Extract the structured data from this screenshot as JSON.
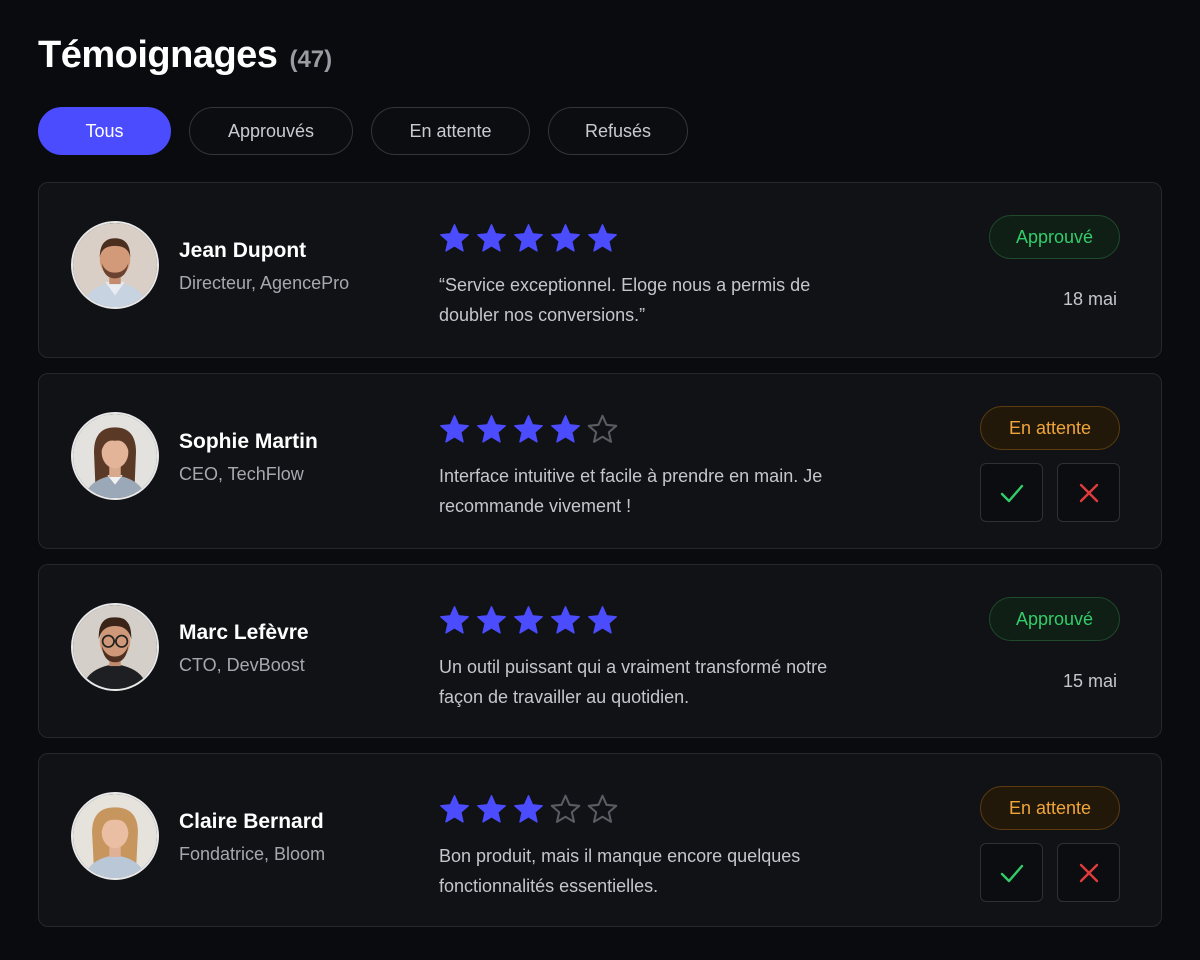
{
  "header": {
    "title": "Témoignages",
    "count": "(47)"
  },
  "tabs": [
    {
      "label": "Tous",
      "active": true
    },
    {
      "label": "Approuvés",
      "active": false
    },
    {
      "label": "En attente",
      "active": false
    },
    {
      "label": "Refusés",
      "active": false
    }
  ],
  "colors": {
    "accent": "#4c4cff",
    "approved": "#33cc6a",
    "pending": "#f0a53a",
    "reject": "#e03b3b",
    "star_empty": "#5a5c63"
  },
  "testimonials": [
    {
      "name": "Jean Dupont",
      "role": "Directeur, AgencePro",
      "rating": 5,
      "quote": "“Service exceptionnel. Eloge nous a permis de doubler nos conversions.”",
      "status": "Approuvé",
      "date": "18 mai"
    },
    {
      "name": "Sophie Martin",
      "role": "CEO, TechFlow",
      "rating": 4,
      "quote": "Interface intuitive et facile à prendre en main. Je recommande vivement !",
      "status": "En attente",
      "date": ""
    },
    {
      "name": "Marc Lefèvre",
      "role": "CTO, DevBoost",
      "rating": 5,
      "quote": "Un outil puissant qui a vraiment transformé notre façon de travailler au quotidien.",
      "status": "Approuvé",
      "date": "15 mai"
    },
    {
      "name": "Claire Bernard",
      "role": "Fondatrice, Bloom",
      "rating": 3,
      "quote": "Bon produit, mais il manque encore quelques fonctionnalités essentielles.",
      "status": "En attente",
      "date": ""
    }
  ],
  "icons": {
    "star": "star-icon",
    "approve": "check-icon",
    "reject": "close-icon"
  }
}
